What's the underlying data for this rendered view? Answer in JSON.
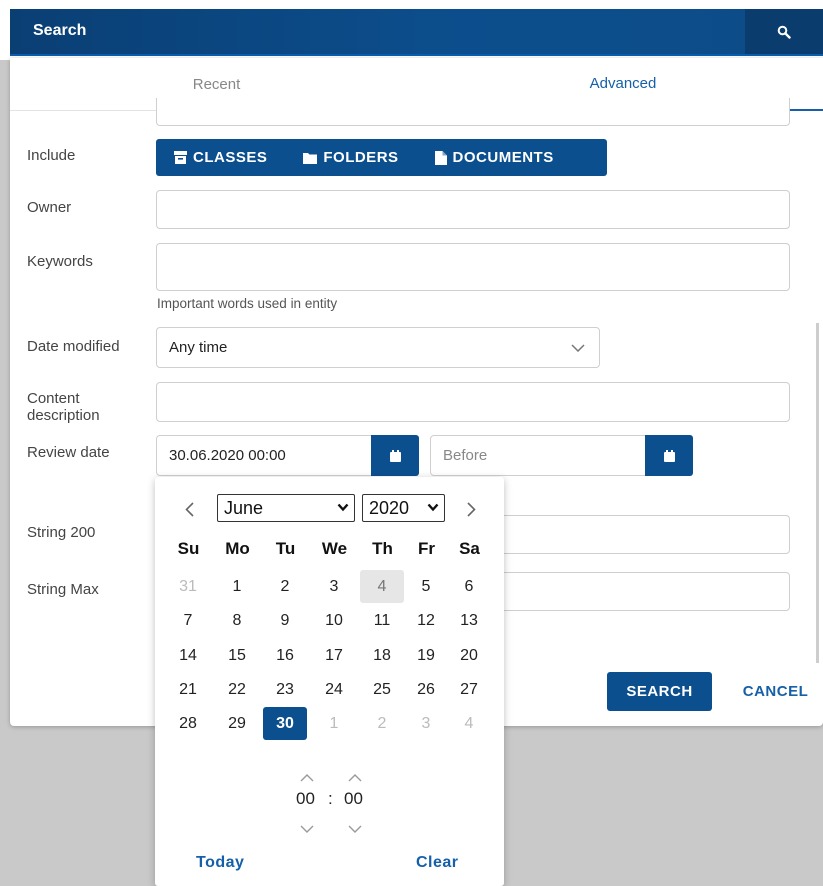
{
  "search_bar": {
    "label": "Search"
  },
  "tabs": {
    "recent": "Recent",
    "advanced": "Advanced"
  },
  "form": {
    "include": {
      "label": "Include",
      "options": [
        "CLASSES",
        "FOLDERS",
        "DOCUMENTS"
      ]
    },
    "owner": {
      "label": "Owner",
      "value": ""
    },
    "keywords": {
      "label": "Keywords",
      "value": "",
      "hint": "Important words used in entity"
    },
    "date_modified": {
      "label": "Date modified",
      "value": "Any time"
    },
    "content_description": {
      "label_line1": "Content",
      "label_line2": "description",
      "value": ""
    },
    "review_date": {
      "label": "Review date",
      "from_value": "30.06.2020 00:00",
      "before_placeholder": "Before"
    },
    "string200": {
      "label": "String 200"
    },
    "string_max": {
      "label": "String Max"
    }
  },
  "actions": {
    "search": "SEARCH",
    "cancel": "CANCEL"
  },
  "datepicker": {
    "month": "June",
    "year": "2020",
    "weekdays": [
      "Su",
      "Mo",
      "Tu",
      "We",
      "Th",
      "Fr",
      "Sa"
    ],
    "weeks": [
      [
        "31",
        "1",
        "2",
        "3",
        "4",
        "5",
        "6"
      ],
      [
        "7",
        "8",
        "9",
        "10",
        "11",
        "12",
        "13"
      ],
      [
        "14",
        "15",
        "16",
        "17",
        "18",
        "19",
        "20"
      ],
      [
        "21",
        "22",
        "23",
        "24",
        "25",
        "26",
        "27"
      ],
      [
        "28",
        "29",
        "30",
        "1",
        "2",
        "3",
        "4"
      ]
    ],
    "time": {
      "hours": "00",
      "separator": ":",
      "minutes": "00"
    },
    "today_label": "Today",
    "clear_label": "Clear"
  },
  "colors": {
    "primary": "#0c4f8f",
    "link": "#1560a8",
    "header_gradient_start": "#0a3f74"
  },
  "icons": [
    "search-icon",
    "archive-icon",
    "folder-icon",
    "document-icon",
    "calendar-icon",
    "chevron-down-icon",
    "chevron-left-icon",
    "chevron-right-icon",
    "chevron-up-icon"
  ]
}
